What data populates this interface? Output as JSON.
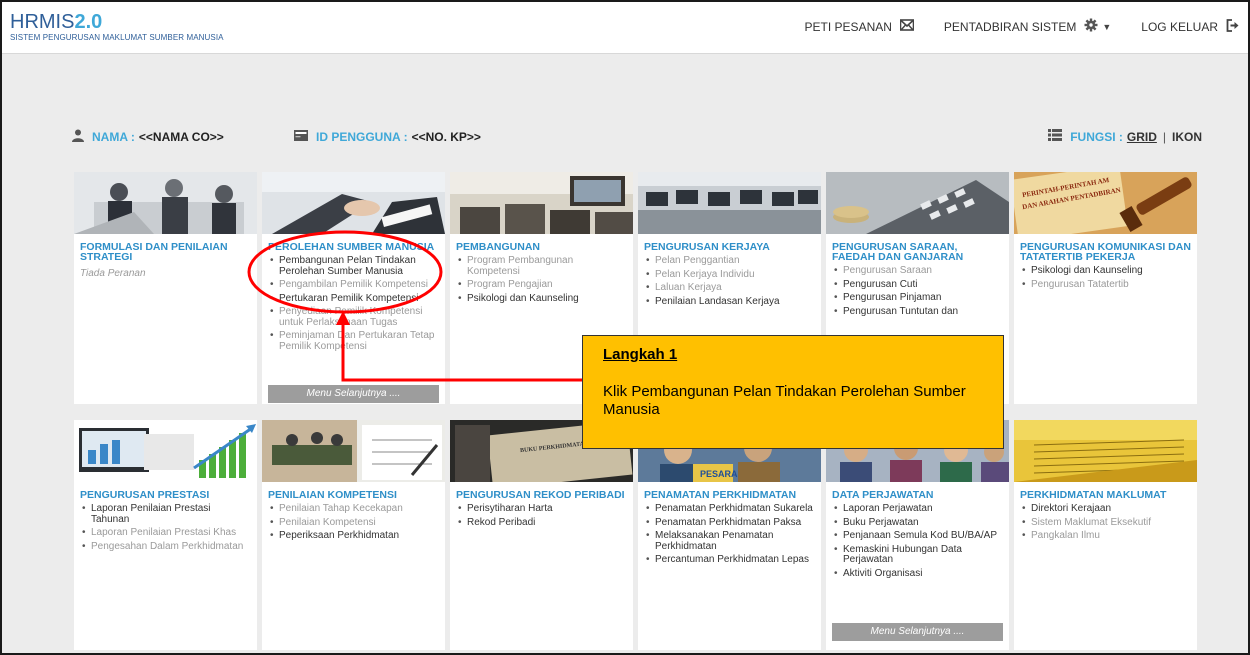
{
  "header": {
    "logo_main": "HRMIS",
    "logo_version": "2.0",
    "logo_sub": "SISTEM PENGURUSAN MAKLUMAT SUMBER MANUSIA",
    "nav": [
      {
        "label": "PETI PESANAN",
        "icon": "envelope-icon"
      },
      {
        "label": "PENTADBIRAN SISTEM",
        "icon": "gear-icon"
      },
      {
        "label": "LOG KELUAR",
        "icon": "logout-icon"
      }
    ]
  },
  "userbar": {
    "nama_label": "NAMA :",
    "nama_value": "<<NAMA CO>>",
    "id_label": "ID PENGGUNA :",
    "id_value": "<<NO. KP>>",
    "fungsi_label": "FUNGSI :",
    "fungsi_grid": "GRID",
    "fungsi_sep": "|",
    "fungsi_ikon": "IKON"
  },
  "tiles": [
    {
      "title": "FORMULASI DAN PENILAIAN STRATEGI",
      "none": "Tiada Peranan",
      "items": []
    },
    {
      "title": "PEROLEHAN SUMBER MANUSIA",
      "items": [
        {
          "label": "Pembangunan Pelan Tindakan Perolehan Sumber Manusia",
          "enabled": true
        },
        {
          "label": "Pengambilan Pemilik Kompetensi",
          "enabled": false
        },
        {
          "label": "Pertukaran Pemilik Kompetensi",
          "enabled": true
        },
        {
          "label": "Penyediaan Pemilik Kompetensi untuk Perlaksanaan Tugas",
          "enabled": false
        },
        {
          "label": "Peminjaman Dan Pertukaran Tetap Pemilik Kompetensi",
          "enabled": false
        }
      ],
      "menu": "Menu Selanjutnya ...."
    },
    {
      "title": "PEMBANGUNAN",
      "items": [
        {
          "label": "Program Pembangunan Kompetensi",
          "enabled": false
        },
        {
          "label": "Program Pengajian",
          "enabled": false
        },
        {
          "label": "Psikologi dan Kaunseling",
          "enabled": true
        }
      ]
    },
    {
      "title": "PENGURUSAN KERJAYA",
      "items": [
        {
          "label": "Pelan Penggantian",
          "enabled": false
        },
        {
          "label": "Pelan Kerjaya Individu",
          "enabled": false
        },
        {
          "label": "Laluan Kerjaya",
          "enabled": false
        },
        {
          "label": "Penilaian Landasan Kerjaya",
          "enabled": true
        }
      ]
    },
    {
      "title": "PENGURUSAN SARAAN, FAEDAH DAN GANJARAN",
      "items": [
        {
          "label": "Pengurusan Saraan",
          "enabled": false
        },
        {
          "label": "Pengurusan Cuti",
          "enabled": true
        },
        {
          "label": "Pengurusan Pinjaman",
          "enabled": true
        },
        {
          "label": "Pengurusan Tuntutan dan",
          "enabled": true
        }
      ]
    },
    {
      "title": "PENGURUSAN KOMUNIKASI DAN TATATERTIB PEKERJA",
      "items": [
        {
          "label": "Psikologi dan Kaunseling",
          "enabled": true
        },
        {
          "label": "Pengurusan Tatatertib",
          "enabled": false
        }
      ]
    },
    {
      "title": "PENGURUSAN PRESTASI",
      "items": [
        {
          "label": "Laporan Penilaian Prestasi Tahunan",
          "enabled": true
        },
        {
          "label": "Laporan Penilaian Prestasi Khas",
          "enabled": false
        },
        {
          "label": "Pengesahan Dalam Perkhidmatan",
          "enabled": false
        }
      ]
    },
    {
      "title": "PENILAIAN KOMPETENSI",
      "items": [
        {
          "label": "Penilaian Tahap Kecekapan",
          "enabled": false
        },
        {
          "label": "Penilaian Kompetensi",
          "enabled": false
        },
        {
          "label": "Peperiksaan Perkhidmatan",
          "enabled": true
        }
      ]
    },
    {
      "title": "PENGURUSAN REKOD PERIBADI",
      "items": [
        {
          "label": "Perisytiharan Harta",
          "enabled": true
        },
        {
          "label": "Rekod Peribadi",
          "enabled": true
        }
      ]
    },
    {
      "title": "PENAMATAN PERKHIDMATAN",
      "items": [
        {
          "label": "Penamatan Perkhidmatan Sukarela",
          "enabled": true
        },
        {
          "label": "Penamatan Perkhidmatan Paksa",
          "enabled": true
        },
        {
          "label": "Melaksanakan Penamatan Perkhidmatan",
          "enabled": true
        },
        {
          "label": "Percantuman Perkhidmatan Lepas",
          "enabled": true
        }
      ]
    },
    {
      "title": "DATA PERJAWATAN",
      "items": [
        {
          "label": "Laporan Perjawatan",
          "enabled": true
        },
        {
          "label": "Buku Perjawatan",
          "enabled": true
        },
        {
          "label": "Penjanaan Semula Kod BU/BA/AP",
          "enabled": true
        },
        {
          "label": "Kemaskini Hubungan Data Perjawatan",
          "enabled": true
        },
        {
          "label": "Aktiviti Organisasi",
          "enabled": true
        }
      ],
      "menu": "Menu Selanjutnya ...."
    },
    {
      "title": "PERKHIDMATAN MAKLUMAT",
      "items": [
        {
          "label": "Direktori Kerajaan",
          "enabled": true
        },
        {
          "label": "Sistem Maklumat Eksekutif",
          "enabled": false
        },
        {
          "label": "Pangkalan Ilmu",
          "enabled": false
        }
      ]
    }
  ],
  "image_texts": {
    "perintah": "PERINTAH-PERINTAH AM",
    "arahan": "DAN ARAHAN PENTADBIRAN",
    "buku": "BUKU PERKHIDMATAN",
    "pesara": "PESARA"
  },
  "callout": {
    "heading": "Langkah 1",
    "body": "Klik Pembangunan Pelan Tindakan Perolehan Sumber Manusia"
  },
  "colors": {
    "accent": "#2f8fc8",
    "callout": "#ffc000",
    "annotation": "#ff0000"
  }
}
